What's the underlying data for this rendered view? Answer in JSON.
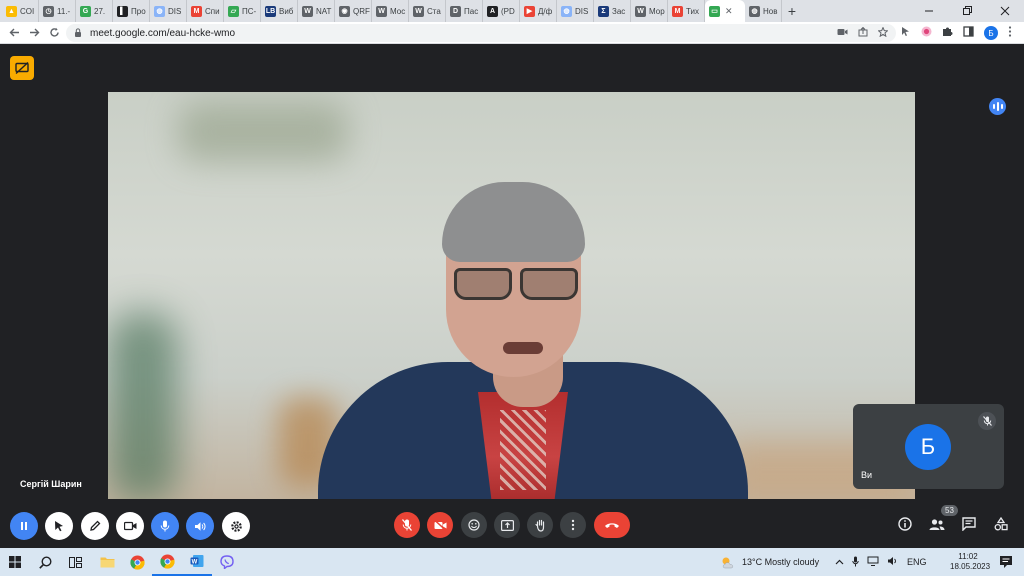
{
  "browser": {
    "tabs": [
      {
        "label": "COI",
        "color": "#fbbc04",
        "glyph": "▲"
      },
      {
        "label": "11.-",
        "color": "#5f6368",
        "glyph": "◷"
      },
      {
        "label": "27.",
        "color": "#34a853",
        "glyph": "G"
      },
      {
        "label": "Про",
        "color": "#202124",
        "glyph": "▌"
      },
      {
        "label": "DIS",
        "color": "#8ab4f8",
        "glyph": "◍"
      },
      {
        "label": "Спи",
        "color": "#ea4335",
        "glyph": "M"
      },
      {
        "label": "ПС-",
        "color": "#34a853",
        "glyph": "▱"
      },
      {
        "label": "Виб",
        "color": "#1a3a7a",
        "glyph": "LB"
      },
      {
        "label": "NAT",
        "color": "#5f6368",
        "glyph": "W"
      },
      {
        "label": "QRF",
        "color": "#5f6368",
        "glyph": "◉"
      },
      {
        "label": "Мос",
        "color": "#5f6368",
        "glyph": "W"
      },
      {
        "label": "Ста",
        "color": "#5f6368",
        "glyph": "W"
      },
      {
        "label": "Пас",
        "color": "#5f6368",
        "glyph": "D"
      },
      {
        "label": "(PD",
        "color": "#202124",
        "glyph": "A"
      },
      {
        "label": "Д/ф",
        "color": "#ea4335",
        "glyph": "▶"
      },
      {
        "label": "DIS",
        "color": "#8ab4f8",
        "glyph": "◍"
      },
      {
        "label": "Зас",
        "color": "#1a3a7a",
        "glyph": "Σ"
      },
      {
        "label": "Мор",
        "color": "#5f6368",
        "glyph": "W"
      },
      {
        "label": "Тих",
        "color": "#ea4335",
        "glyph": "M"
      },
      {
        "label": "",
        "color": "#34a853",
        "glyph": "▭",
        "active": true
      },
      {
        "label": "Нов",
        "color": "#5f6368",
        "glyph": "◍"
      }
    ],
    "active_tab_close": "✕",
    "new_tab": "+",
    "url": "meet.google.com/eau-hcke-wmo",
    "profile_initial": "Б"
  },
  "meet": {
    "speaker_name": "Сергій Шарин",
    "self_name": "Ви",
    "self_initial": "Б",
    "participant_count": "53",
    "colors": {
      "leave": "#ea4335",
      "avatar": "#1a73e8",
      "pen_blue": "#4285f4"
    }
  },
  "taskbar": {
    "weather": "13°C  Mostly cloudy",
    "lang": "ENG",
    "time": "11:02",
    "date": "18.05.2023"
  }
}
